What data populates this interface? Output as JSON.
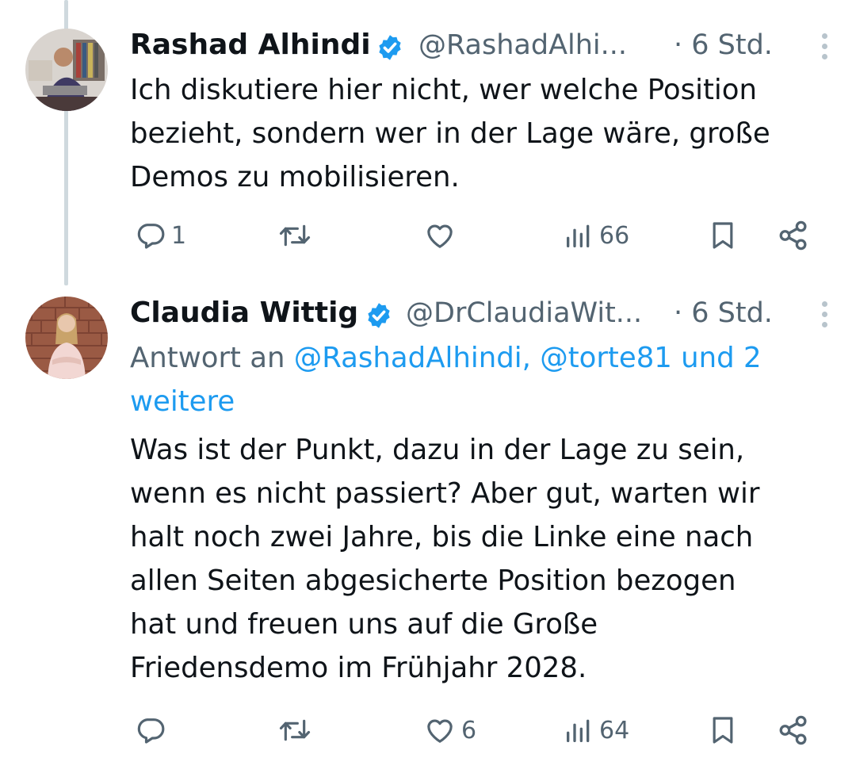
{
  "tweets": [
    {
      "author_name": "Rashad Alhindi",
      "handle": "@RashadAlhi...",
      "time": "· 6 Std.",
      "reply_prefix": "",
      "reply_mentions": "",
      "text_lines": [
        "Ich diskutiere hier nicht, wer welche Position",
        "bezieht, sondern wer in der Lage wäre, große",
        "Demos zu mobilisieren."
      ],
      "reply_count": "1",
      "retweet_count": "",
      "like_count": "",
      "view_count": "66"
    },
    {
      "author_name": "Claudia Wittig",
      "handle": "@DrClaudiaWit...",
      "time": "· 6 Std.",
      "reply_prefix": "Antwort an ",
      "reply_mentions_line1": "@RashadAlhindi, @torte81 und 2",
      "reply_mentions_line2": "weitere",
      "text_lines": [
        "Was ist der Punkt, dazu in der Lage zu sein,",
        "wenn es nicht passiert? Aber gut, warten wir",
        "halt noch zwei Jahre, bis die Linke eine nach",
        "allen Seiten abgesicherte Position bezogen",
        "hat und freuen uns auf die Große",
        "Friedensdemo im Frühjahr 2028."
      ],
      "reply_count": "",
      "retweet_count": "",
      "like_count": "6",
      "view_count": "64"
    }
  ],
  "icons": {
    "reply": "reply-icon",
    "retweet": "retweet-icon",
    "like": "heart-icon",
    "views": "views-icon",
    "bookmark": "bookmark-icon",
    "share": "share-icon",
    "verified": "verified-badge-icon",
    "more": "more-vertical-icon"
  },
  "colors": {
    "text": "#0f1419",
    "secondary": "#536471",
    "link": "#1d9bf0",
    "thread_line": "#cfd9de"
  }
}
